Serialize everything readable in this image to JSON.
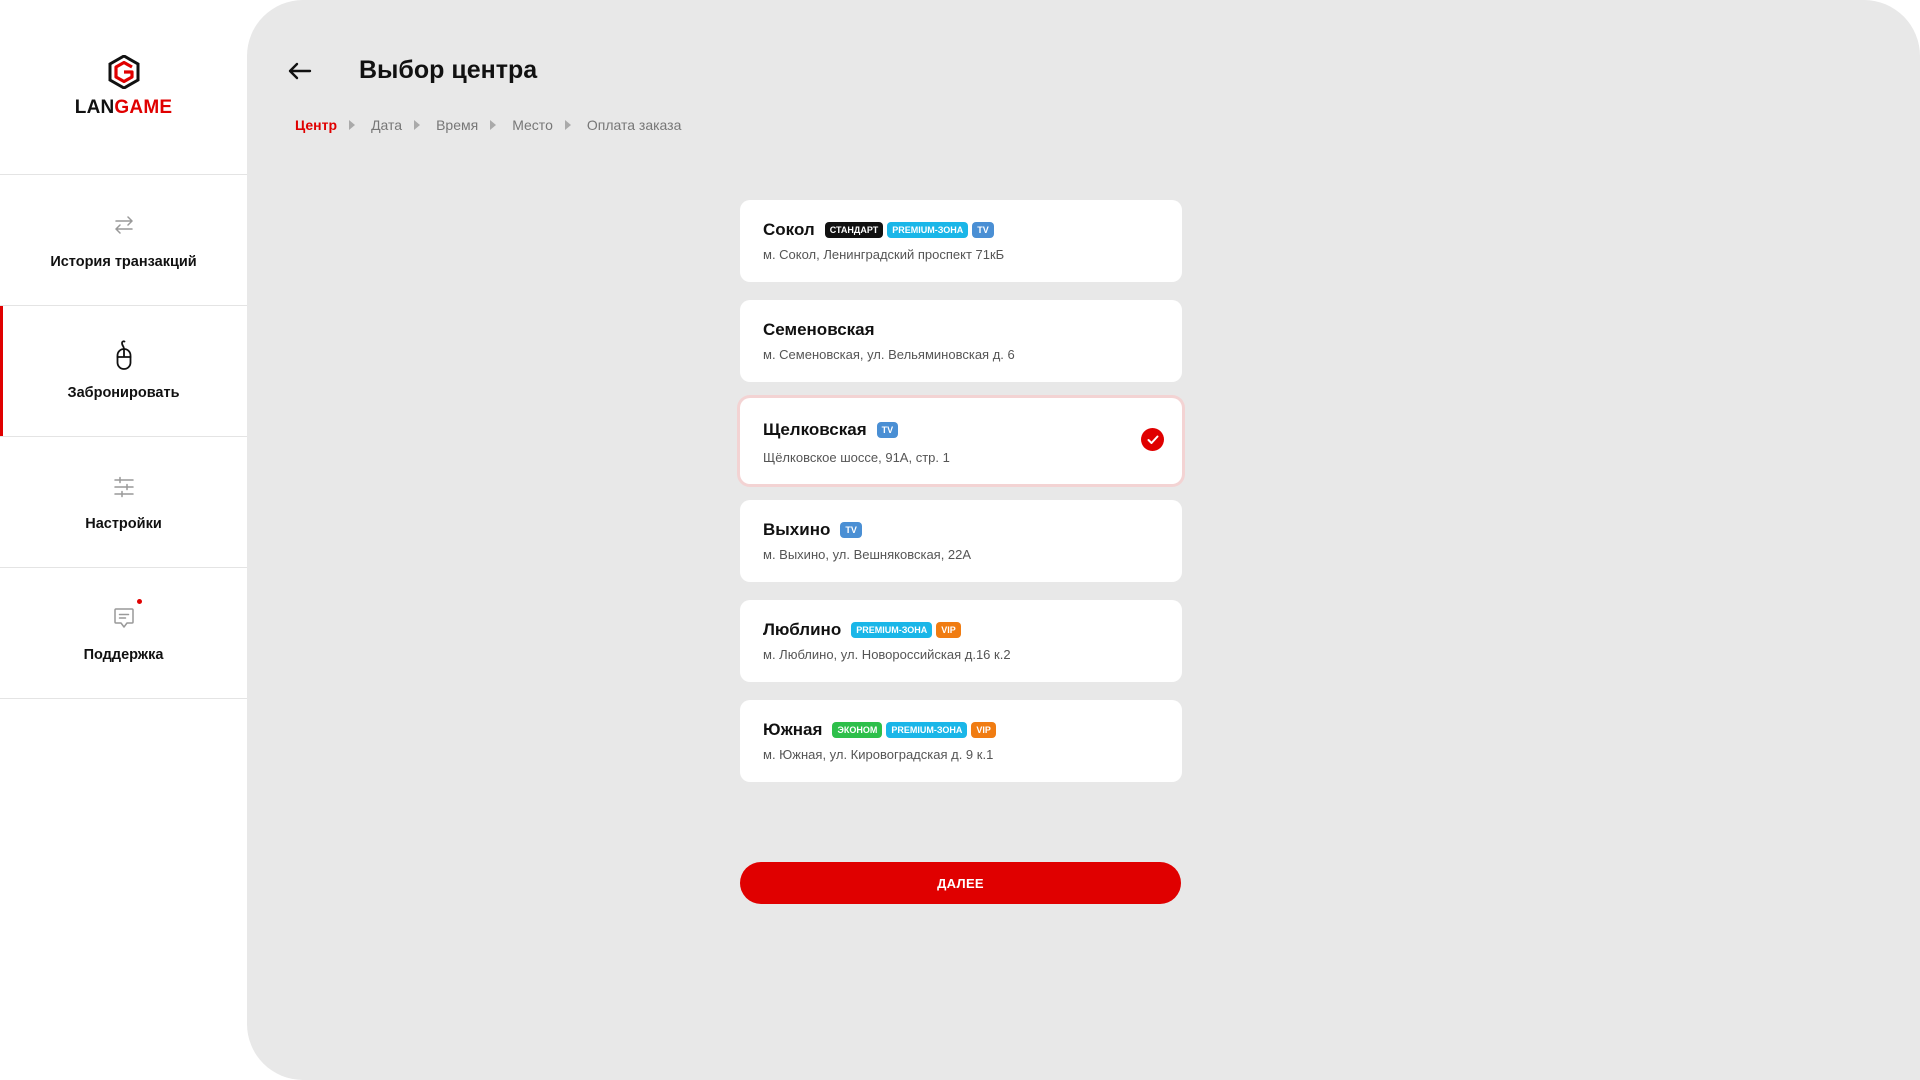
{
  "brand": {
    "logo_part1": "LAN",
    "logo_part2": "GAME",
    "accent_color": "#e00000"
  },
  "sidebar": {
    "items": [
      {
        "label": "История транзакций",
        "icon": "transfer-arrows-icon",
        "active": false
      },
      {
        "label": "Забронировать",
        "icon": "mouse-icon",
        "active": true
      },
      {
        "label": "Настройки",
        "icon": "sliders-icon",
        "active": false
      },
      {
        "label": "Поддержка",
        "icon": "chat-icon",
        "active": false,
        "notification": true
      }
    ]
  },
  "header": {
    "title": "Выбор центра",
    "back_icon": "arrow-left-icon"
  },
  "breadcrumb": {
    "steps": [
      "Центр",
      "Дата",
      "Время",
      "Место",
      "Оплата заказа"
    ],
    "active_index": 0
  },
  "centers": [
    {
      "name": "Сокол",
      "address": "м. Сокол, Ленинградский проспект 71кБ",
      "badges": [
        {
          "text": "стандарт",
          "color": "#111111"
        },
        {
          "text": "premium-зона",
          "color": "#1ab6e8"
        },
        {
          "text": "tv",
          "color": "#4a8fd4"
        }
      ],
      "selected": false
    },
    {
      "name": "Семеновская",
      "address": "м. Семеновская, ул. Вельяминовская д. 6",
      "badges": [],
      "selected": false
    },
    {
      "name": "Щелковская",
      "address": "Щёлковское шоссе, 91А, стр. 1",
      "badges": [
        {
          "text": "tv",
          "color": "#4a8fd4"
        }
      ],
      "selected": true
    },
    {
      "name": "Выхино",
      "address": "м. Выхино, ул. Вешняковская, 22А",
      "badges": [
        {
          "text": "tv",
          "color": "#4a8fd4"
        }
      ],
      "selected": false
    },
    {
      "name": "Люблино",
      "address": "м. Люблино, ул. Новороссийская д.16 к.2",
      "badges": [
        {
          "text": "premium-зона",
          "color": "#1ab6e8"
        },
        {
          "text": "vip",
          "color": "#f07c12"
        }
      ],
      "selected": false
    },
    {
      "name": "Южная",
      "address": "м. Южная, ул. Кировоградская д. 9 к.1",
      "badges": [
        {
          "text": "эконом",
          "color": "#2dbf4a"
        },
        {
          "text": "premium-зона",
          "color": "#1ab6e8"
        },
        {
          "text": "vip",
          "color": "#f07c12"
        }
      ],
      "selected": false
    }
  ],
  "next_button": {
    "label": "ДАЛЕЕ"
  }
}
